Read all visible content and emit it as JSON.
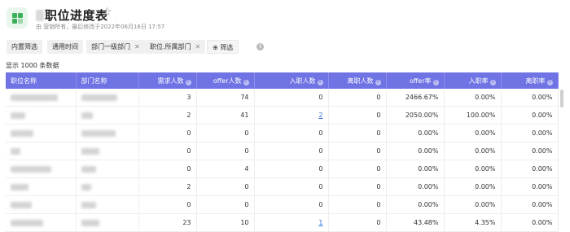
{
  "header": {
    "title": "职位进度表",
    "subtitle": "由 营销所有，最后修改于2022年06月16日 17:57"
  },
  "filters": [
    {
      "label": "内置筛选",
      "removable": false
    },
    {
      "label": "通用时间",
      "removable": false
    },
    {
      "label": "部门一级部门",
      "removable": true
    },
    {
      "label": "职位.所属部门",
      "removable": true
    }
  ],
  "add_filter_label": "筛选",
  "record_count": "显示 1000 条数据",
  "table": {
    "columns": [
      "职位名称",
      "部门名称",
      "需求人数",
      "offer人数",
      "入职人数",
      "离职人数",
      "offer率",
      "入职率",
      "离职率"
    ],
    "rows": [
      {
        "req": "3",
        "offer": "74",
        "hired": "0",
        "left": "0",
        "offer_rate": "2466.67%",
        "hire_rate": "0.00%",
        "leave_rate": "0.00%",
        "hired_link": false
      },
      {
        "req": "2",
        "offer": "41",
        "hired": "2",
        "left": "0",
        "offer_rate": "2050.00%",
        "hire_rate": "100.00%",
        "leave_rate": "0.00%",
        "hired_link": true
      },
      {
        "req": "0",
        "offer": "0",
        "hired": "0",
        "left": "0",
        "offer_rate": "0.00%",
        "hire_rate": "0.00%",
        "leave_rate": "0.00%",
        "hired_link": false
      },
      {
        "req": "0",
        "offer": "0",
        "hired": "0",
        "left": "0",
        "offer_rate": "0.00%",
        "hire_rate": "0.00%",
        "leave_rate": "0.00%",
        "hired_link": false
      },
      {
        "req": "0",
        "offer": "4",
        "hired": "0",
        "left": "0",
        "offer_rate": "0.00%",
        "hire_rate": "0.00%",
        "leave_rate": "0.00%",
        "hired_link": false
      },
      {
        "req": "2",
        "offer": "0",
        "hired": "0",
        "left": "0",
        "offer_rate": "0.00%",
        "hire_rate": "0.00%",
        "leave_rate": "0.00%",
        "hired_link": false
      },
      {
        "req": "0",
        "offer": "0",
        "hired": "0",
        "left": "0",
        "offer_rate": "0.00%",
        "hire_rate": "0.00%",
        "leave_rate": "0.00%",
        "hired_link": false
      },
      {
        "req": "23",
        "offer": "10",
        "hired": "1",
        "left": "0",
        "offer_rate": "43.48%",
        "hire_rate": "4.35%",
        "leave_rate": "0.00%",
        "hired_link": true
      }
    ]
  },
  "colors": {
    "header_bg": "#6f73e4",
    "link": "#2f6fd6",
    "app_icon": "#3fb05a"
  }
}
